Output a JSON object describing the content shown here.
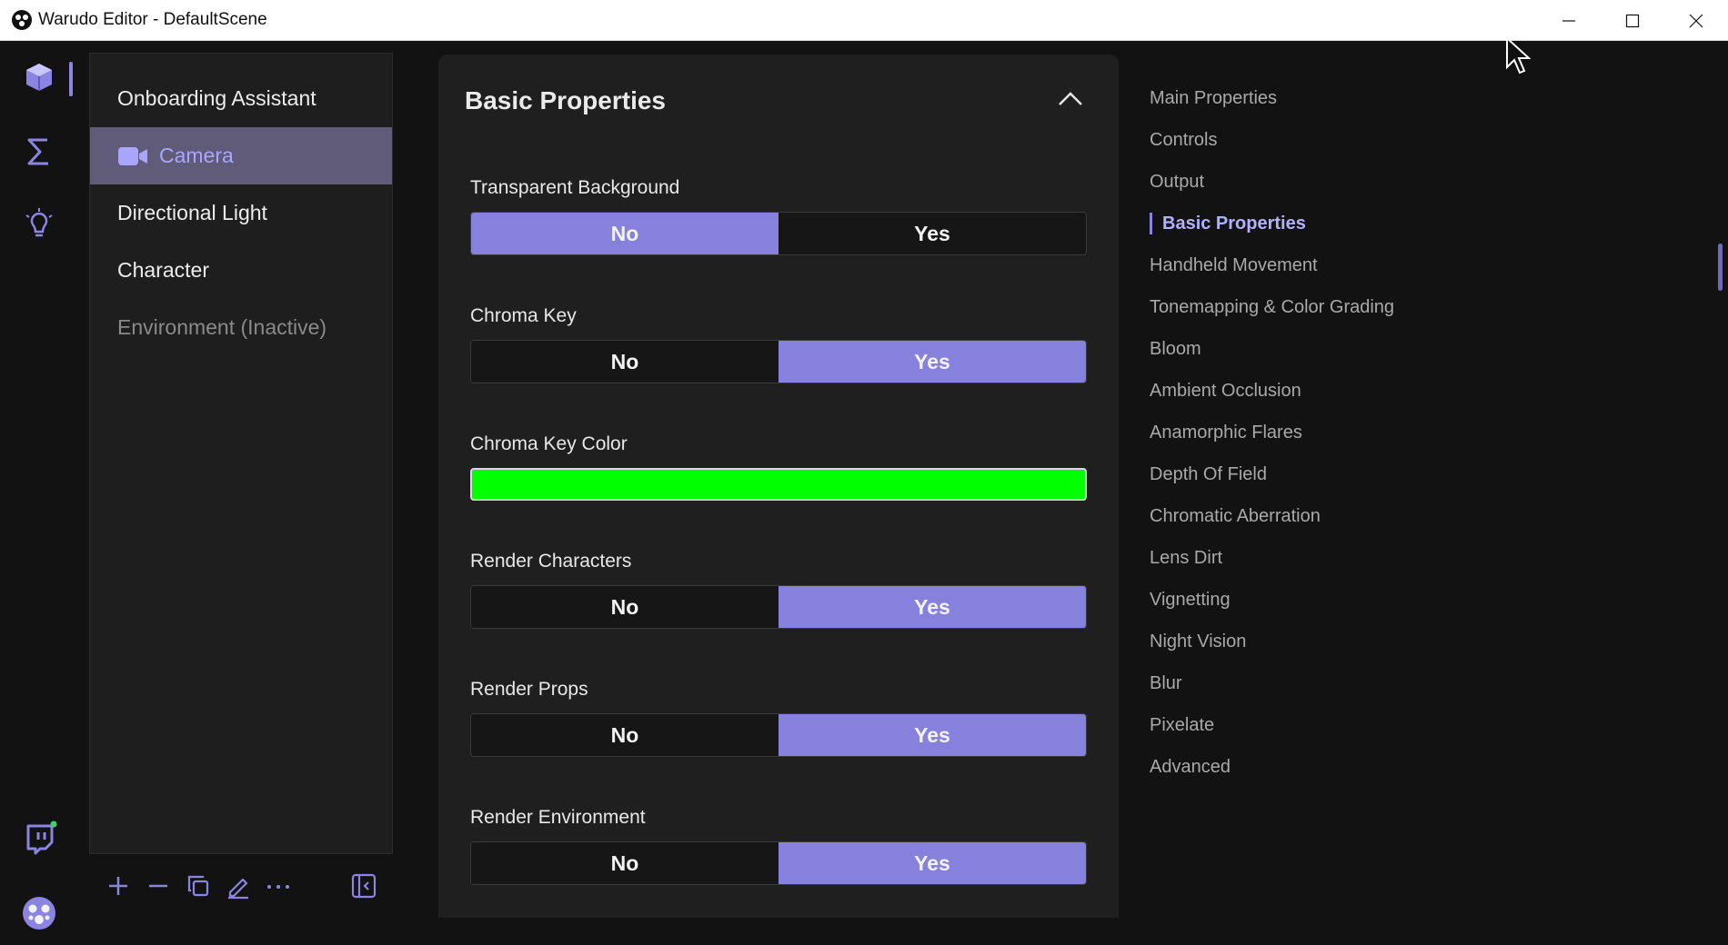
{
  "window": {
    "title": "Warudo Editor - DefaultScene"
  },
  "rail": {
    "items": [
      {
        "name": "scene-cube-icon",
        "active": true
      },
      {
        "name": "sigma-icon",
        "active": false
      },
      {
        "name": "lightbulb-icon",
        "active": false
      },
      {
        "name": "twitch-icon",
        "active": false
      },
      {
        "name": "warudo-logo-icon",
        "active": false
      }
    ]
  },
  "scene_list": {
    "items": [
      {
        "label": "Onboarding Assistant",
        "state": "normal"
      },
      {
        "label": "Camera",
        "state": "active"
      },
      {
        "label": "Directional Light",
        "state": "normal"
      },
      {
        "label": "Character",
        "state": "normal"
      },
      {
        "label": "Environment (Inactive)",
        "state": "inactive"
      }
    ],
    "toolbar": [
      "plus-icon",
      "minus-icon",
      "duplicate-icon",
      "rename-icon",
      "more-icon",
      "toggle-panel-icon"
    ]
  },
  "properties": {
    "section_title": "Basic Properties",
    "fields": [
      {
        "label": "Transparent Background",
        "no": "No",
        "yes": "Yes",
        "selected": "No"
      },
      {
        "label": "Chroma Key",
        "no": "No",
        "yes": "Yes",
        "selected": "Yes"
      },
      {
        "label": "Chroma Key Color",
        "color": "#00ff00"
      },
      {
        "label": "Render Characters",
        "no": "No",
        "yes": "Yes",
        "selected": "Yes"
      },
      {
        "label": "Render Props",
        "no": "No",
        "yes": "Yes",
        "selected": "Yes"
      },
      {
        "label": "Render Environment",
        "no": "No",
        "yes": "Yes",
        "selected": "Yes"
      }
    ]
  },
  "nav": {
    "items": [
      "Main Properties",
      "Controls",
      "Output",
      "Basic Properties",
      "Handheld Movement",
      "Tonemapping & Color Grading",
      "Bloom",
      "Ambient Occlusion",
      "Anamorphic Flares",
      "Depth Of Field",
      "Chromatic Aberration",
      "Lens Dirt",
      "Vignetting",
      "Night Vision",
      "Blur",
      "Pixelate",
      "Advanced"
    ],
    "active": "Basic Properties"
  },
  "colors": {
    "accent": "#8781de",
    "accent_text": "#b3b0ff",
    "background": "#121212",
    "panel": "#1f1f1f"
  }
}
